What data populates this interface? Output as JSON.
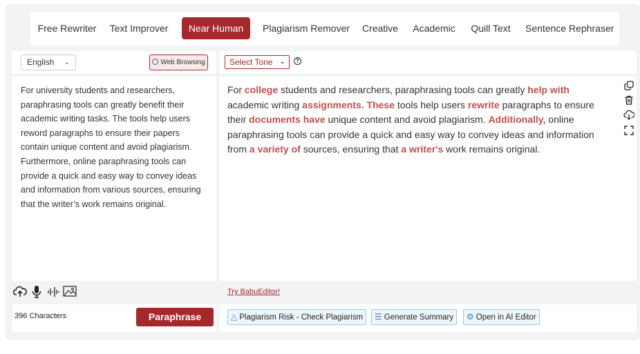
{
  "modes": [
    {
      "label": "Free Rewriter",
      "active": false
    },
    {
      "label": "Text Improver",
      "active": false
    },
    {
      "label": "Near Human",
      "active": true
    },
    {
      "label": "Plagiarism Remover",
      "active": false
    },
    {
      "label": "Creative",
      "active": false
    },
    {
      "label": "Academic",
      "active": false
    },
    {
      "label": "Quill Text",
      "active": false
    },
    {
      "label": "Sentence Rephraser",
      "active": false
    }
  ],
  "left": {
    "language": "English",
    "web_browsing_label": "Web Browsing",
    "input_text": "For university students and researchers, paraphrasing tools can greatly benefit their academic writing tasks. The tools help users reword paragraphs to ensure their papers contain unique content and avoid plagiarism. Furthermore, online paraphrasing tools can provide a quick and easy way to convey ideas and information from various sources, ensuring that the writer’s work remains original.",
    "char_count": "396 Characters",
    "paraphrase_label": "Paraphrase"
  },
  "right": {
    "tone_label": "Select Tone",
    "help_glyph": "?",
    "output_segments": [
      {
        "t": "For ",
        "h": false
      },
      {
        "t": "college",
        "h": true
      },
      {
        "t": " students and researchers, paraphrasing tools can greatly ",
        "h": false
      },
      {
        "t": "help with",
        "h": true
      },
      {
        "t": " academic writing ",
        "h": false
      },
      {
        "t": "assignments. These",
        "h": true
      },
      {
        "t": " tools help users ",
        "h": false
      },
      {
        "t": "rewrite",
        "h": true
      },
      {
        "t": " paragraphs to ensure their ",
        "h": false
      },
      {
        "t": "documents have",
        "h": true
      },
      {
        "t": " unique content and avoid plagiarism. ",
        "h": false
      },
      {
        "t": "Additionally,",
        "h": true
      },
      {
        "t": " online paraphrasing tools can provide a quick and easy way to convey ideas and information from ",
        "h": false
      },
      {
        "t": "a variety of",
        "h": true
      },
      {
        "t": " sources, ensuring that ",
        "h": false
      },
      {
        "t": "a writer's",
        "h": true
      },
      {
        "t": " work remains original.",
        "h": false
      }
    ],
    "try_link": "Try BabuEditor!",
    "actions": {
      "plagiarism": "Plagiarism Risk - Check Plagiarism",
      "summary": "Generate Summary",
      "ai_editor": "Open in AI Editor"
    }
  },
  "colors": {
    "accent": "#a5282d",
    "highlight": "#c0504d",
    "action_border": "#9cc8e8"
  }
}
